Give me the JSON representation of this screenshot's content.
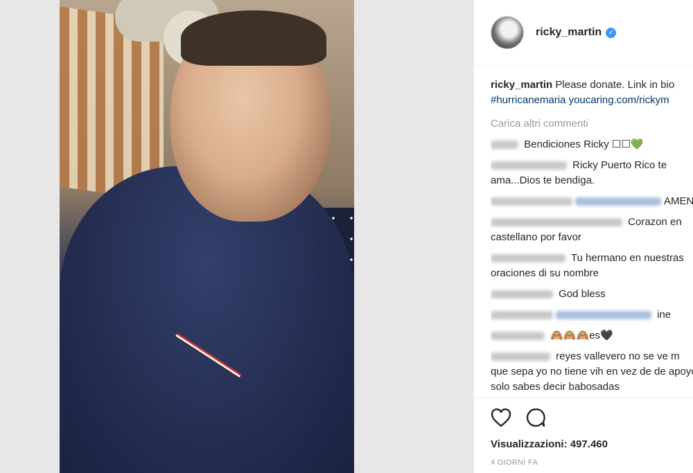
{
  "post": {
    "username": "ricky_martin",
    "verified_mark": "✓",
    "caption_user": "ricky_martin",
    "caption_text": "Please donate. Link in bio",
    "hashtag": "#hurricanemaria",
    "caption_link": "youcaring.com/rickym",
    "load_more": "Carica altri commenti",
    "views_label": "Visualizzazioni: 497.460",
    "time_ago": "4 GIORNI FA"
  },
  "comments": [
    {
      "text": "Bendiciones Ricky ☐☐💚"
    },
    {
      "text": "Ricky Puerto Rico te ama...Dios te bendiga."
    },
    {
      "text": "AMEN"
    },
    {
      "text": "Corazon en castellano por favor"
    },
    {
      "text": "Tu hermano en nuestras oraciones di su nombre"
    },
    {
      "text": "God bless"
    },
    {
      "text": "ine"
    },
    {
      "text": "🙈🙈🙈es🖤"
    },
    {
      "text": "reyes vallevero no se ve m que sepa yo no tiene vih en vez de de apoyo solo sabes decir babosadas"
    }
  ],
  "icons": {
    "like": "heart-icon",
    "comment": "comment-icon"
  },
  "colors": {
    "accent": "#3897f0",
    "link": "#003569",
    "muted": "#999999"
  }
}
